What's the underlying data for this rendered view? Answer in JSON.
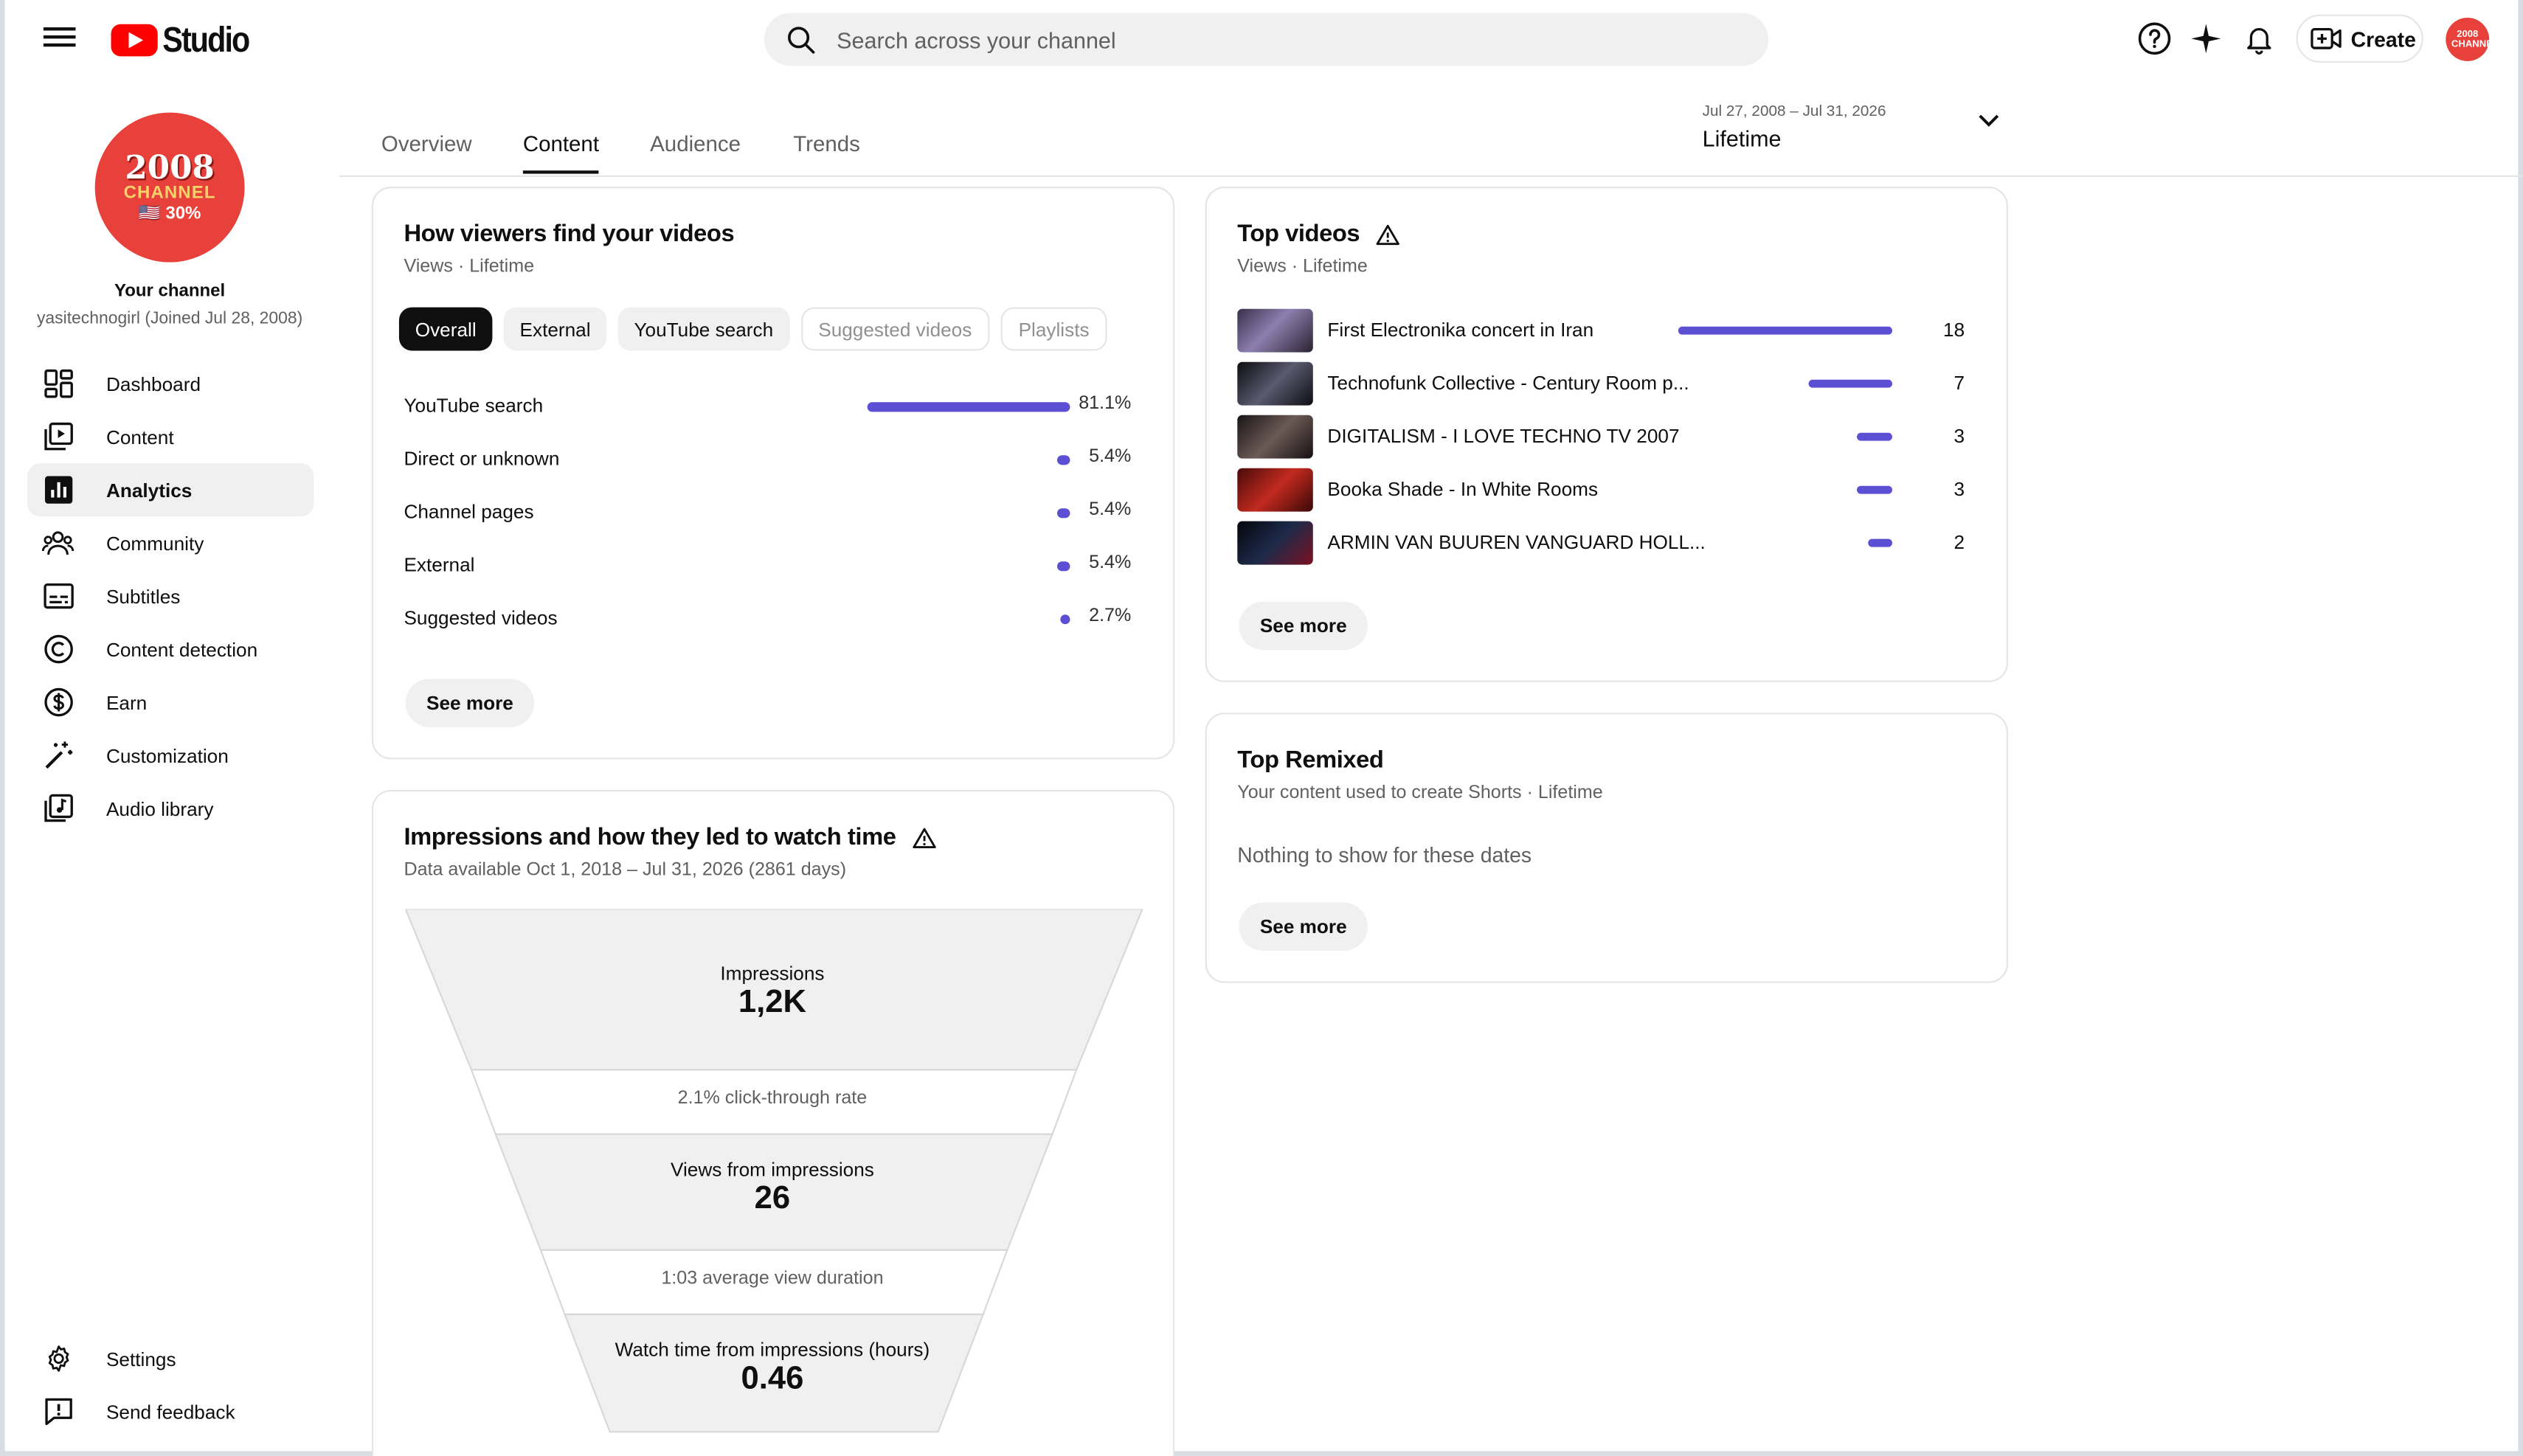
{
  "header": {
    "logo_text": "Studio",
    "search_placeholder": "Search across your channel",
    "create_label": "Create",
    "avatar_text": "2008 CHANNEL"
  },
  "sidebar": {
    "avatar_line1": "2008",
    "avatar_line2": "CHANNEL",
    "avatar_line3": "🇺🇸 30%",
    "your_channel": "Your channel",
    "channel_meta": "yasitechnogirl (Joined Jul 28, 2008)",
    "items": [
      {
        "label": "Dashboard",
        "icon": "dashboard-icon"
      },
      {
        "label": "Content",
        "icon": "content-icon"
      },
      {
        "label": "Analytics",
        "icon": "analytics-icon"
      },
      {
        "label": "Community",
        "icon": "community-icon"
      },
      {
        "label": "Subtitles",
        "icon": "subtitles-icon"
      },
      {
        "label": "Content detection",
        "icon": "copyright-icon"
      },
      {
        "label": "Earn",
        "icon": "dollar-icon"
      },
      {
        "label": "Customization",
        "icon": "magic-wand-icon"
      },
      {
        "label": "Audio library",
        "icon": "audio-library-icon"
      }
    ],
    "bottom_items": [
      {
        "label": "Settings",
        "icon": "gear-icon"
      },
      {
        "label": "Send feedback",
        "icon": "feedback-icon"
      }
    ]
  },
  "tabs": [
    "Overview",
    "Content",
    "Audience",
    "Trends"
  ],
  "date_range": {
    "range": "Jul 27, 2008 – Jul 31, 2026",
    "label": "Lifetime"
  },
  "traffic_sources": {
    "title": "How viewers find your videos",
    "subtitle": "Views · Lifetime",
    "chips": [
      "Overall",
      "External",
      "YouTube search",
      "Suggested videos",
      "Playlists"
    ],
    "rows": [
      {
        "label": "YouTube search",
        "value": "81.1%",
        "fraction": 0.811
      },
      {
        "label": "Direct or unknown",
        "value": "5.4%",
        "fraction": 0.054
      },
      {
        "label": "Channel pages",
        "value": "5.4%",
        "fraction": 0.054
      },
      {
        "label": "External",
        "value": "5.4%",
        "fraction": 0.054
      },
      {
        "label": "Suggested videos",
        "value": "2.7%",
        "fraction": 0.027
      }
    ],
    "see_more": "See more"
  },
  "top_videos": {
    "title": "Top videos",
    "subtitle": "Views · Lifetime",
    "rows": [
      {
        "title": "First Electronika concert in Iran",
        "views": "18",
        "count": 18
      },
      {
        "title": "Technofunk Collective - Century Room p...",
        "views": "7",
        "count": 7
      },
      {
        "title": "DIGITALISM - I LOVE TECHNO TV 2007",
        "views": "3",
        "count": 3
      },
      {
        "title": "Booka Shade - In White Rooms",
        "views": "3",
        "count": 3
      },
      {
        "title": "ARMIN VAN BUUREN VANGUARD HOLL...",
        "views": "2",
        "count": 2
      }
    ],
    "see_more": "See more"
  },
  "top_remixed": {
    "title": "Top Remixed",
    "subtitle": "Your content used to create Shorts · Lifetime",
    "empty": "Nothing to show for these dates",
    "see_more": "See more"
  },
  "impressions": {
    "title": "Impressions and how they led to watch time",
    "subtitle": "Data available Oct 1, 2018 – Jul 31, 2026 (2861 days)",
    "impressions_label": "Impressions",
    "impressions_value": "1,2K",
    "ctr": "2.1% click-through rate",
    "views_label": "Views from impressions",
    "views_value": "26",
    "avd": "1:03 average view duration",
    "watch_label": "Watch time from impressions (hours)",
    "watch_value": "0.46"
  },
  "colors": {
    "accent": "#5c4fd3",
    "brand_red": "#ff0000",
    "avatar_red": "#e8403a"
  }
}
